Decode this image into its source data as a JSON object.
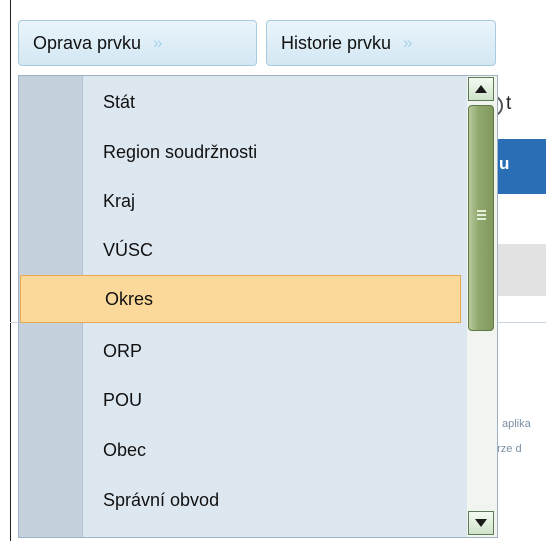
{
  "toolbar": {
    "oprava_label": "Oprava prvku",
    "historie_label": "Historie prvku",
    "chevron": "»"
  },
  "background": {
    "radio_label": "t",
    "table_header": "u",
    "note_line1": "aplika",
    "note_line2": "erze d"
  },
  "dropdown": {
    "items": [
      {
        "label": "Stát"
      },
      {
        "label": "Region soudržnosti"
      },
      {
        "label": "Kraj"
      },
      {
        "label": "VÚSC"
      },
      {
        "label": "Okres",
        "selected": true
      },
      {
        "label": "ORP"
      },
      {
        "label": "POU"
      },
      {
        "label": "Obec"
      },
      {
        "label": "Správní obvod"
      }
    ]
  },
  "colors": {
    "selected_bg": "#fbd99a",
    "header_blue": "#2a6fb5",
    "scroll_thumb": "#90a86e"
  }
}
